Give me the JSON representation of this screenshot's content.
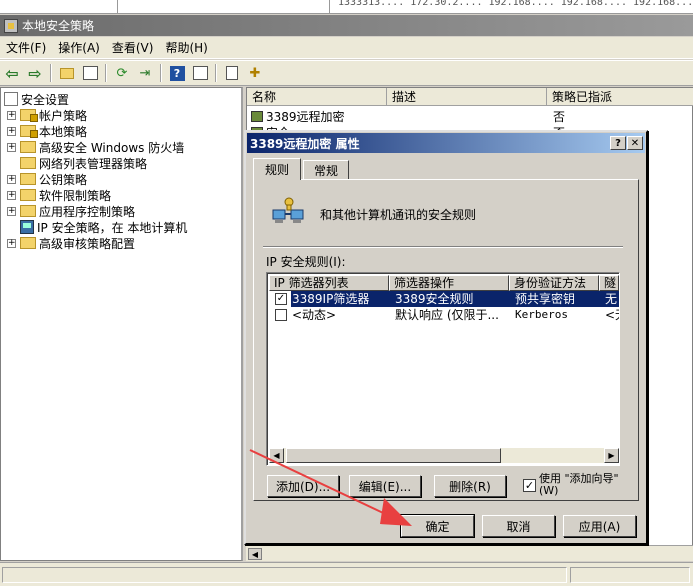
{
  "bg_strip": {
    "text": "1333313.... 172.30.2.... 192.168.... 192.168.... 192.168...."
  },
  "window": {
    "title": "本地安全策略"
  },
  "menu": [
    {
      "label": "文件(F)"
    },
    {
      "label": "操作(A)"
    },
    {
      "label": "查看(V)"
    },
    {
      "label": "帮助(H)"
    }
  ],
  "tree": {
    "root": "安全设置",
    "items": [
      {
        "label": "帐户策略"
      },
      {
        "label": "本地策略"
      },
      {
        "label": "高级安全 Windows 防火墙"
      },
      {
        "label": "网络列表管理器策略"
      },
      {
        "label": "公钥策略"
      },
      {
        "label": "软件限制策略"
      },
      {
        "label": "应用程序控制策略"
      },
      {
        "label": "IP 安全策略，在 本地计算机"
      },
      {
        "label": "高级审核策略配置"
      }
    ]
  },
  "list": {
    "columns": [
      "名称",
      "描述",
      "策略已指派"
    ],
    "rows": [
      {
        "name": "3389远程加密",
        "assigned": "否"
      },
      {
        "name": "安全 ...",
        "assigned": "否"
      }
    ]
  },
  "dialog": {
    "title": "3389远程加密 属性",
    "help_button": "?",
    "close_button": "✕",
    "tabs": [
      {
        "label": "规则"
      },
      {
        "label": "常规"
      }
    ],
    "description": "和其他计算机通讯的安全规则",
    "rules_label": "IP 安全规则(I):",
    "rule_columns": [
      "IP 筛选器列表",
      "筛选器操作",
      "身份验证方法",
      "隧"
    ],
    "rules": [
      {
        "checked": true,
        "filter_list": "3389IP筛选器",
        "filter_action": "3389安全规则",
        "auth": "预共享密钥",
        "tunnel": "无"
      },
      {
        "checked": false,
        "filter_list": "<动态>",
        "filter_action": "默认响应 (仅限于...",
        "auth": "Kerberos",
        "tunnel": "<无"
      }
    ],
    "buttons": {
      "add": "添加(D)...",
      "edit": "编辑(E)...",
      "remove": "删除(R)",
      "wizard_label": "使用 \"添加向导\"(W)",
      "ok": "确定",
      "cancel": "取消",
      "apply": "应用(A)"
    },
    "wizard_checked": true
  },
  "colors": {
    "title_active": "#0a246a",
    "selection": "#0a246a",
    "arrow": "#e84040"
  }
}
